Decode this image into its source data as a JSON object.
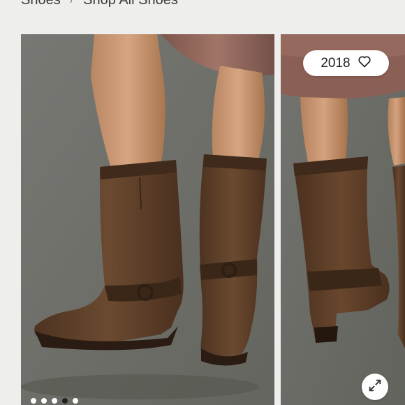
{
  "breadcrumb": {
    "items": [
      {
        "label": "Shoes"
      },
      {
        "label": "Shop All Shoes"
      }
    ],
    "separator": "/"
  },
  "gallery": {
    "slide_count": 5,
    "active_slide_index": 3,
    "slides": [
      {
        "alt": "brown-harness-boots-on-model-front"
      },
      {
        "alt": "brown-harness-boots-on-model-side"
      }
    ]
  },
  "favorite": {
    "count": "2018",
    "icon": "heart-outline-icon"
  },
  "expand": {
    "icon": "expand-arrows-icon"
  },
  "colors": {
    "page_bg": "#eeeeec",
    "photo_bg": "#6f706c",
    "boot_brown": "#5e3f28",
    "skirt_mauve": "#8a5f55"
  }
}
